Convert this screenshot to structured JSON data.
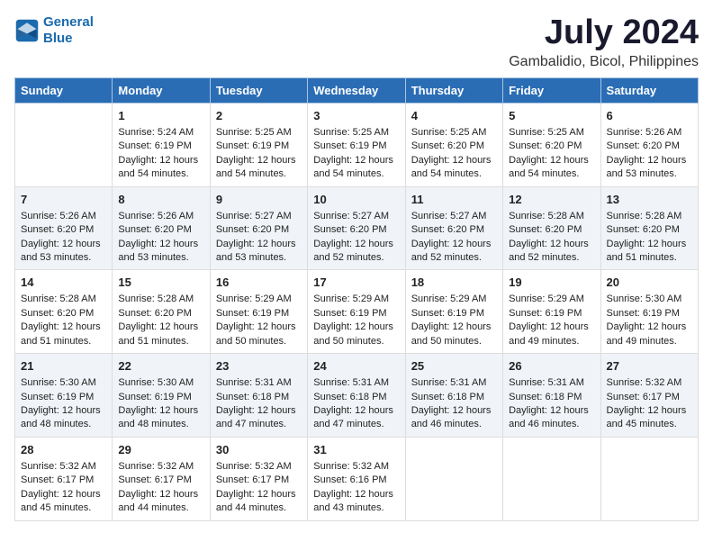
{
  "header": {
    "logo_line1": "General",
    "logo_line2": "Blue",
    "title": "July 2024",
    "subtitle": "Gambalidio, Bicol, Philippines"
  },
  "columns": [
    "Sunday",
    "Monday",
    "Tuesday",
    "Wednesday",
    "Thursday",
    "Friday",
    "Saturday"
  ],
  "weeks": [
    [
      {
        "day": "",
        "sunrise": "",
        "sunset": "",
        "daylight": ""
      },
      {
        "day": "1",
        "sunrise": "Sunrise: 5:24 AM",
        "sunset": "Sunset: 6:19 PM",
        "daylight": "Daylight: 12 hours and 54 minutes."
      },
      {
        "day": "2",
        "sunrise": "Sunrise: 5:25 AM",
        "sunset": "Sunset: 6:19 PM",
        "daylight": "Daylight: 12 hours and 54 minutes."
      },
      {
        "day": "3",
        "sunrise": "Sunrise: 5:25 AM",
        "sunset": "Sunset: 6:19 PM",
        "daylight": "Daylight: 12 hours and 54 minutes."
      },
      {
        "day": "4",
        "sunrise": "Sunrise: 5:25 AM",
        "sunset": "Sunset: 6:20 PM",
        "daylight": "Daylight: 12 hours and 54 minutes."
      },
      {
        "day": "5",
        "sunrise": "Sunrise: 5:25 AM",
        "sunset": "Sunset: 6:20 PM",
        "daylight": "Daylight: 12 hours and 54 minutes."
      },
      {
        "day": "6",
        "sunrise": "Sunrise: 5:26 AM",
        "sunset": "Sunset: 6:20 PM",
        "daylight": "Daylight: 12 hours and 53 minutes."
      }
    ],
    [
      {
        "day": "7",
        "sunrise": "Sunrise: 5:26 AM",
        "sunset": "Sunset: 6:20 PM",
        "daylight": "Daylight: 12 hours and 53 minutes."
      },
      {
        "day": "8",
        "sunrise": "Sunrise: 5:26 AM",
        "sunset": "Sunset: 6:20 PM",
        "daylight": "Daylight: 12 hours and 53 minutes."
      },
      {
        "day": "9",
        "sunrise": "Sunrise: 5:27 AM",
        "sunset": "Sunset: 6:20 PM",
        "daylight": "Daylight: 12 hours and 53 minutes."
      },
      {
        "day": "10",
        "sunrise": "Sunrise: 5:27 AM",
        "sunset": "Sunset: 6:20 PM",
        "daylight": "Daylight: 12 hours and 52 minutes."
      },
      {
        "day": "11",
        "sunrise": "Sunrise: 5:27 AM",
        "sunset": "Sunset: 6:20 PM",
        "daylight": "Daylight: 12 hours and 52 minutes."
      },
      {
        "day": "12",
        "sunrise": "Sunrise: 5:28 AM",
        "sunset": "Sunset: 6:20 PM",
        "daylight": "Daylight: 12 hours and 52 minutes."
      },
      {
        "day": "13",
        "sunrise": "Sunrise: 5:28 AM",
        "sunset": "Sunset: 6:20 PM",
        "daylight": "Daylight: 12 hours and 51 minutes."
      }
    ],
    [
      {
        "day": "14",
        "sunrise": "Sunrise: 5:28 AM",
        "sunset": "Sunset: 6:20 PM",
        "daylight": "Daylight: 12 hours and 51 minutes."
      },
      {
        "day": "15",
        "sunrise": "Sunrise: 5:28 AM",
        "sunset": "Sunset: 6:20 PM",
        "daylight": "Daylight: 12 hours and 51 minutes."
      },
      {
        "day": "16",
        "sunrise": "Sunrise: 5:29 AM",
        "sunset": "Sunset: 6:19 PM",
        "daylight": "Daylight: 12 hours and 50 minutes."
      },
      {
        "day": "17",
        "sunrise": "Sunrise: 5:29 AM",
        "sunset": "Sunset: 6:19 PM",
        "daylight": "Daylight: 12 hours and 50 minutes."
      },
      {
        "day": "18",
        "sunrise": "Sunrise: 5:29 AM",
        "sunset": "Sunset: 6:19 PM",
        "daylight": "Daylight: 12 hours and 50 minutes."
      },
      {
        "day": "19",
        "sunrise": "Sunrise: 5:29 AM",
        "sunset": "Sunset: 6:19 PM",
        "daylight": "Daylight: 12 hours and 49 minutes."
      },
      {
        "day": "20",
        "sunrise": "Sunrise: 5:30 AM",
        "sunset": "Sunset: 6:19 PM",
        "daylight": "Daylight: 12 hours and 49 minutes."
      }
    ],
    [
      {
        "day": "21",
        "sunrise": "Sunrise: 5:30 AM",
        "sunset": "Sunset: 6:19 PM",
        "daylight": "Daylight: 12 hours and 48 minutes."
      },
      {
        "day": "22",
        "sunrise": "Sunrise: 5:30 AM",
        "sunset": "Sunset: 6:19 PM",
        "daylight": "Daylight: 12 hours and 48 minutes."
      },
      {
        "day": "23",
        "sunrise": "Sunrise: 5:31 AM",
        "sunset": "Sunset: 6:18 PM",
        "daylight": "Daylight: 12 hours and 47 minutes."
      },
      {
        "day": "24",
        "sunrise": "Sunrise: 5:31 AM",
        "sunset": "Sunset: 6:18 PM",
        "daylight": "Daylight: 12 hours and 47 minutes."
      },
      {
        "day": "25",
        "sunrise": "Sunrise: 5:31 AM",
        "sunset": "Sunset: 6:18 PM",
        "daylight": "Daylight: 12 hours and 46 minutes."
      },
      {
        "day": "26",
        "sunrise": "Sunrise: 5:31 AM",
        "sunset": "Sunset: 6:18 PM",
        "daylight": "Daylight: 12 hours and 46 minutes."
      },
      {
        "day": "27",
        "sunrise": "Sunrise: 5:32 AM",
        "sunset": "Sunset: 6:17 PM",
        "daylight": "Daylight: 12 hours and 45 minutes."
      }
    ],
    [
      {
        "day": "28",
        "sunrise": "Sunrise: 5:32 AM",
        "sunset": "Sunset: 6:17 PM",
        "daylight": "Daylight: 12 hours and 45 minutes."
      },
      {
        "day": "29",
        "sunrise": "Sunrise: 5:32 AM",
        "sunset": "Sunset: 6:17 PM",
        "daylight": "Daylight: 12 hours and 44 minutes."
      },
      {
        "day": "30",
        "sunrise": "Sunrise: 5:32 AM",
        "sunset": "Sunset: 6:17 PM",
        "daylight": "Daylight: 12 hours and 44 minutes."
      },
      {
        "day": "31",
        "sunrise": "Sunrise: 5:32 AM",
        "sunset": "Sunset: 6:16 PM",
        "daylight": "Daylight: 12 hours and 43 minutes."
      },
      {
        "day": "",
        "sunrise": "",
        "sunset": "",
        "daylight": ""
      },
      {
        "day": "",
        "sunrise": "",
        "sunset": "",
        "daylight": ""
      },
      {
        "day": "",
        "sunrise": "",
        "sunset": "",
        "daylight": ""
      }
    ]
  ]
}
